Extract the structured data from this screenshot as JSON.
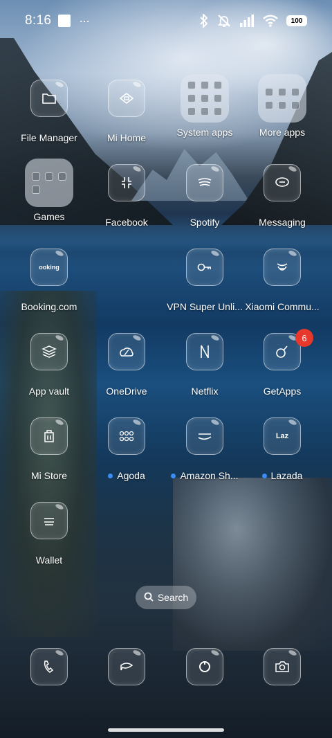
{
  "status_bar": {
    "time": "8:16",
    "more": "···",
    "battery": "100"
  },
  "apps": [
    {
      "label": "File Manager",
      "icon": "folder-icon"
    },
    {
      "label": "Mi Home",
      "icon": "mi-home-icon"
    },
    {
      "label": "System apps",
      "icon": "folder-icon"
    },
    {
      "label": "More apps",
      "icon": "folder-icon"
    },
    {
      "label": "Games",
      "icon": "folder-icon"
    },
    {
      "label": "Facebook",
      "icon": "facebook-icon"
    },
    {
      "label": "Spotify",
      "icon": "spotify-icon"
    },
    {
      "label": "Messaging",
      "icon": "message-icon"
    },
    {
      "label": "Booking.com",
      "icon": "booking-icon",
      "glyph": "ooking"
    },
    {
      "label": "VPN Super Unli...",
      "icon": "key-icon"
    },
    {
      "label": "Xiaomi Commu...",
      "icon": "xiaomi-community-icon"
    },
    {
      "label": "App vault",
      "icon": "app-vault-icon"
    },
    {
      "label": "OneDrive",
      "icon": "onedrive-icon"
    },
    {
      "label": "Netflix",
      "icon": "netflix-icon"
    },
    {
      "label": "GetApps",
      "icon": "getapps-icon",
      "badge": "6"
    },
    {
      "label": "Mi Store",
      "icon": "mi-store-icon"
    },
    {
      "label": "Agoda",
      "icon": "agoda-icon",
      "new_dot": true
    },
    {
      "label": "Amazon Sh...",
      "icon": "amazon-icon",
      "new_dot": true
    },
    {
      "label": "Lazada",
      "icon": "lazada-icon",
      "new_dot": true,
      "glyph": "Laz"
    },
    {
      "label": "Wallet",
      "icon": "wallet-icon"
    }
  ],
  "search": {
    "label": "Search"
  },
  "dock": [
    {
      "icon": "phone-icon"
    },
    {
      "icon": "messages-icon"
    },
    {
      "icon": "browser-icon"
    },
    {
      "icon": "camera-icon"
    }
  ],
  "colors": {
    "badge": "#e8372b",
    "new_dot": "#3b8df5"
  }
}
